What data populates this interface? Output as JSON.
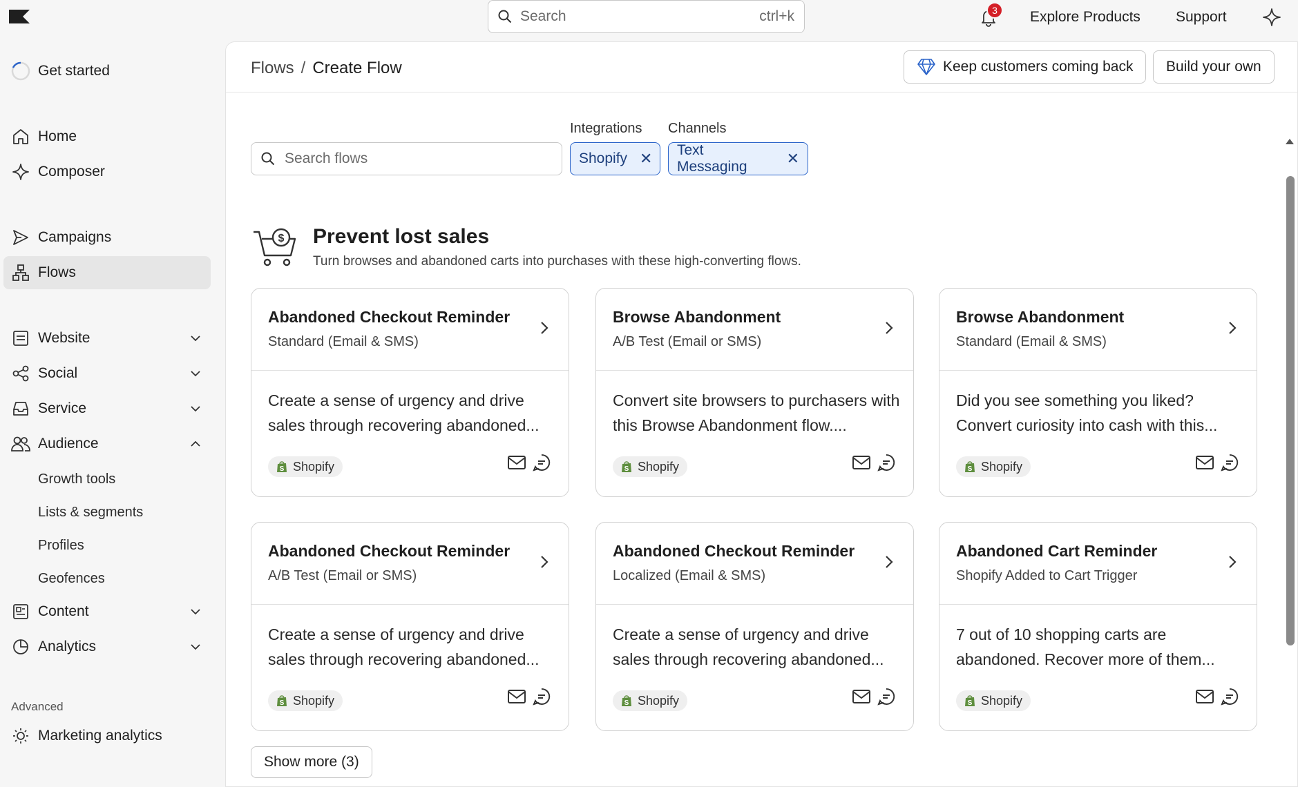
{
  "topbar": {
    "search_placeholder": "Search",
    "search_shortcut": "ctrl+k",
    "notification_count": "3",
    "explore_products": "Explore Products",
    "support": "Support"
  },
  "sidebar": {
    "get_started": "Get started",
    "home": "Home",
    "composer": "Composer",
    "campaigns": "Campaigns",
    "flows": "Flows",
    "website": "Website",
    "social": "Social",
    "service": "Service",
    "audience": "Audience",
    "audience_sub": [
      "Growth tools",
      "Lists & segments",
      "Profiles",
      "Geofences"
    ],
    "content": "Content",
    "analytics": "Analytics",
    "advanced_label": "Advanced",
    "marketing_analytics": "Marketing analytics"
  },
  "header": {
    "breadcrumb_root": "Flows",
    "breadcrumb_sep": "/",
    "breadcrumb_current": "Create Flow",
    "keep_customers_button": "Keep customers coming back",
    "build_own_button": "Build your own"
  },
  "filters": {
    "search_placeholder": "Search flows",
    "integrations_label": "Integrations",
    "channels_label": "Channels",
    "integration_chip": "Shopify",
    "channel_chip": "Text Messaging",
    "chip_remove": "✕"
  },
  "section": {
    "title": "Prevent lost sales",
    "subtitle": "Turn browses and abandoned carts into purchases with these high-converting flows."
  },
  "cards": [
    {
      "title": "Abandoned Checkout Reminder",
      "subtitle": "Standard (Email & SMS)",
      "description": "Create a sense of urgency and drive sales through recovering abandoned...",
      "tag": "Shopify"
    },
    {
      "title": "Browse Abandonment",
      "subtitle": "A/B Test (Email or SMS)",
      "description": "Convert site browsers to purchasers with this Browse Abandonment flow....",
      "tag": "Shopify"
    },
    {
      "title": "Browse Abandonment",
      "subtitle": "Standard (Email & SMS)",
      "description": "Did you see something you liked? Convert curiosity into cash with this...",
      "tag": "Shopify"
    },
    {
      "title": "Abandoned Checkout Reminder",
      "subtitle": "A/B Test (Email or SMS)",
      "description": "Create a sense of urgency and drive sales through recovering abandoned...",
      "tag": "Shopify"
    },
    {
      "title": "Abandoned Checkout Reminder",
      "subtitle": "Localized (Email & SMS)",
      "description": "Create a sense of urgency and drive sales through recovering abandoned...",
      "tag": "Shopify"
    },
    {
      "title": "Abandoned Cart Reminder",
      "subtitle": "Shopify Added to Cart Trigger",
      "description": "7 out of 10 shopping carts are abandoned. Recover more of them...",
      "tag": "Shopify"
    }
  ],
  "show_more": "Show more (3)",
  "colors": {
    "accent": "#2a63c9",
    "chip_bg": "#e7f0fd",
    "badge": "#d41f27",
    "shopify_green": "#5e8e3e"
  }
}
